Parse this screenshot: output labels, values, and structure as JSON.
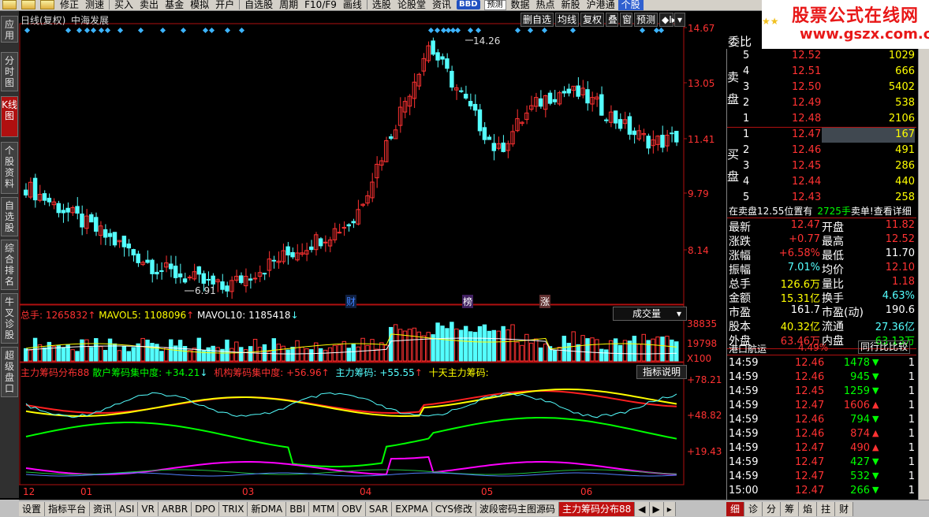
{
  "toolbar": {
    "items": [
      "修正",
      "测速",
      "买入",
      "卖出",
      "基金",
      "模拟",
      "开户",
      "自选股",
      "周期",
      "F10/F9",
      "画线",
      "选股",
      "论股堂",
      "资讯",
      "预测",
      "数据",
      "热点",
      "新股",
      "沪港通"
    ],
    "bbd": "BBD",
    "pred_btn": "预测",
    "last": "个股"
  },
  "logo": {
    "title": "股票公式在线网",
    "url": "www.gszx.com.cn",
    "stars": "★★"
  },
  "left_tabs": [
    "应用",
    "分时图",
    "K线图",
    "个股资料",
    "自选股",
    "综合排名",
    "牛叉诊股",
    "超级盘口"
  ],
  "chart": {
    "title": "日线(复权)",
    "name": "中海发展",
    "controls": [
      "删自选",
      "均线",
      "复权",
      "叠",
      "窗",
      "预测",
      "◆I▸",
      "▾"
    ],
    "price_axis": [
      "14.67",
      "13.05",
      "11.41",
      "9.79",
      "8.14"
    ],
    "high_label": "14.26",
    "low_label": "6.91",
    "markers": [
      "财",
      "榜",
      "涨"
    ],
    "vol_legend": {
      "total_label": "总手:",
      "total": "1265832",
      "mavol5_label": "MAVOL5:",
      "mavol5": "1108096",
      "mavol10_label": "MAVOL10:",
      "mavol10": "1185418"
    },
    "vol_select": "成交量",
    "vol_axis": [
      "38835",
      "19798",
      "X100"
    ],
    "ind_legend": {
      "name": "主力筹码分布88",
      "retail_label": "散户筹码集中度:",
      "retail": "+34.21",
      "inst_label": "机构筹码集中度:",
      "inst": "+56.96",
      "main_label": "主力筹码:",
      "main": "+55.55",
      "ten_label": "十天主力筹码:"
    },
    "ind_btn": "指标说明",
    "ind_axis": [
      "+78.21",
      "+48.82",
      "+19.43"
    ],
    "x_axis": [
      "12",
      "01",
      "03",
      "04",
      "05",
      "06"
    ]
  },
  "quote": {
    "header": "委比",
    "sell_label": "卖盘",
    "buy_label": "买盘",
    "sell": [
      {
        "n": "5",
        "price": "12.52",
        "vol": "1029"
      },
      {
        "n": "4",
        "price": "12.51",
        "vol": "666"
      },
      {
        "n": "3",
        "price": "12.50",
        "vol": "5402"
      },
      {
        "n": "2",
        "price": "12.49",
        "vol": "538"
      },
      {
        "n": "1",
        "price": "12.48",
        "vol": "2106"
      }
    ],
    "buy": [
      {
        "n": "1",
        "price": "12.47",
        "vol": "167"
      },
      {
        "n": "2",
        "price": "12.46",
        "vol": "491"
      },
      {
        "n": "3",
        "price": "12.45",
        "vol": "286"
      },
      {
        "n": "4",
        "price": "12.44",
        "vol": "440"
      },
      {
        "n": "5",
        "price": "12.43",
        "vol": "258"
      }
    ],
    "notice_a": "在卖盘",
    "notice_b": "12.55位置有",
    "notice_c": "2725手",
    "notice_d": "卖单!",
    "notice_e": "查看详细",
    "stats": [
      {
        "l": "最新",
        "v": "12.47",
        "l2": "开盘",
        "v2": "11.82"
      },
      {
        "l": "涨跌",
        "v": "+0.77",
        "l2": "最高",
        "v2": "12.52"
      },
      {
        "l": "涨幅",
        "v": "+6.58%",
        "l2": "最低",
        "v2": "11.70"
      },
      {
        "l": "振幅",
        "v": "7.01%",
        "l2": "均价",
        "v2": "12.10"
      },
      {
        "l": "总手",
        "v": "126.6万",
        "l2": "量比",
        "v2": "1.18"
      },
      {
        "l": "金额",
        "v": "15.31亿",
        "l2": "换手",
        "v2": "4.63%"
      },
      {
        "l": "市盈",
        "v": "161.7",
        "l2": "市盈(动)",
        "v2": "190.6"
      },
      {
        "l": "股本",
        "v": "40.32亿",
        "l2": "流通",
        "v2": "27.36亿"
      },
      {
        "l": "外盘",
        "v": "63.46万",
        "l2": "内盘",
        "v2": "63.13万"
      }
    ],
    "sector": "港口航运",
    "sector_pct": "4.49%",
    "sector_btn": "同行比比较",
    "ticks": [
      {
        "t": "14:59",
        "p": "12.46",
        "v": "1478",
        "d": "down",
        "n": "1"
      },
      {
        "t": "14:59",
        "p": "12.46",
        "v": "945",
        "d": "down",
        "n": "1"
      },
      {
        "t": "14:59",
        "p": "12.45",
        "v": "1259",
        "d": "down",
        "n": "1"
      },
      {
        "t": "14:59",
        "p": "12.47",
        "v": "1606",
        "d": "up",
        "n": "1"
      },
      {
        "t": "14:59",
        "p": "12.46",
        "v": "794",
        "d": "down",
        "n": "1"
      },
      {
        "t": "14:59",
        "p": "12.46",
        "v": "874",
        "d": "up",
        "n": "1"
      },
      {
        "t": "14:59",
        "p": "12.47",
        "v": "490",
        "d": "up",
        "n": "1"
      },
      {
        "t": "14:59",
        "p": "12.47",
        "v": "427",
        "d": "down",
        "n": "1"
      },
      {
        "t": "14:59",
        "p": "12.47",
        "v": "532",
        "d": "down",
        "n": "1"
      },
      {
        "t": "15:00",
        "p": "12.47",
        "v": "266",
        "d": "down",
        "n": "1"
      }
    ]
  },
  "bottom_tabs": [
    "设置",
    "指标平台",
    "资讯",
    "ASI",
    "VR",
    "ARBR",
    "DPO",
    "TRIX",
    "新DMA",
    "BBI",
    "MTM",
    "OBV",
    "SAR",
    "EXPMA",
    "CYS修改",
    "波段密码主图源码",
    "主力筹码分布88"
  ],
  "right_bottom_tabs": [
    "细",
    "诊",
    "分",
    "筹",
    "焰",
    "拄",
    "财"
  ],
  "colors": {
    "up": "#ff3232",
    "down": "#54ffff",
    "yellow": "#ffff00",
    "green": "#00ff00",
    "magenta": "#ff00ff",
    "axis": "#b01010"
  }
}
